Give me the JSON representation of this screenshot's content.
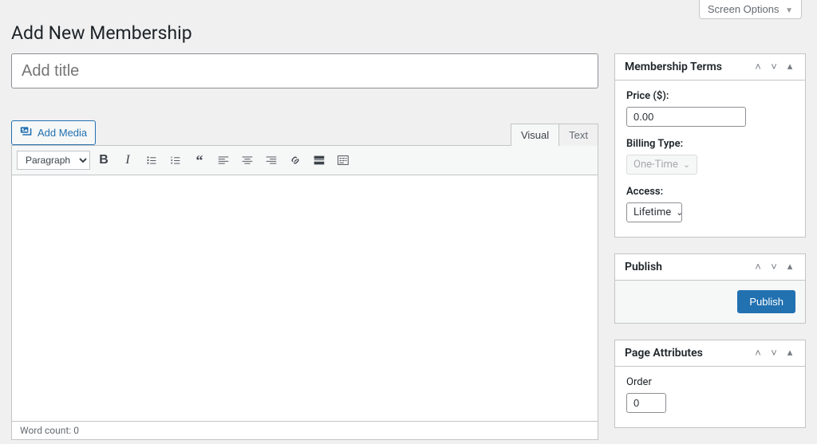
{
  "screen_options_label": "Screen Options",
  "page_title": "Add New Membership",
  "title_placeholder": "Add title",
  "add_media_label": "Add Media",
  "editor_tabs": {
    "visual": "Visual",
    "text": "Text"
  },
  "format_select_label": "Paragraph",
  "word_count_label": "Word count:",
  "word_count_value": "0",
  "panels": {
    "membership_terms": {
      "title": "Membership Terms",
      "price_label": "Price ($):",
      "price_value": "0.00",
      "billing_type_label": "Billing Type:",
      "billing_type_value": "One-Time",
      "access_label": "Access:",
      "access_value": "Lifetime"
    },
    "publish": {
      "title": "Publish",
      "button_label": "Publish"
    },
    "page_attributes": {
      "title": "Page Attributes",
      "order_label": "Order",
      "order_value": "0"
    }
  }
}
